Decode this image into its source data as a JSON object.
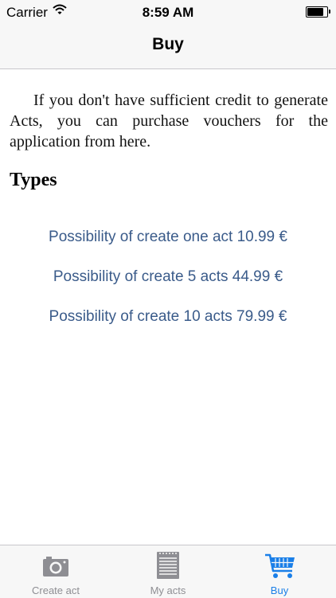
{
  "status_bar": {
    "carrier": "Carrier",
    "time": "8:59 AM",
    "battery_level": 0.9
  },
  "nav": {
    "title": "Buy"
  },
  "content": {
    "intro": "If you don't have sufficient credit to generate Acts, you can purchase vouchers for the application from here.",
    "types_heading": "Types",
    "options": [
      {
        "label": "Possibility of create one act 10.99 €"
      },
      {
        "label": "Possibility of create 5 acts 44.99 €"
      },
      {
        "label": "Possibility of create 10 acts 79.99 €"
      }
    ]
  },
  "tab_bar": {
    "items": [
      {
        "label": "Create act",
        "icon": "camera-icon"
      },
      {
        "label": "My acts",
        "icon": "notepad-icon"
      },
      {
        "label": "Buy",
        "icon": "cart-icon",
        "selected": true
      }
    ],
    "colors": {
      "inactive": "#8e8e93",
      "active": "#1a7fe8"
    }
  },
  "colors": {
    "link": "#3a5b8a"
  }
}
